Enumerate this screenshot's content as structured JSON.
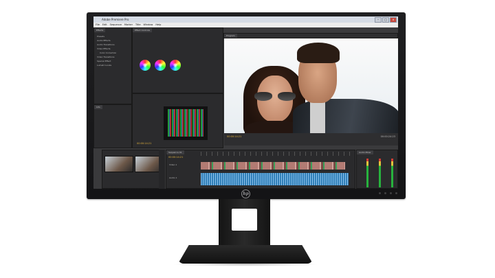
{
  "app": {
    "window_title": "Adobe Premiere Pro",
    "menu": [
      "File",
      "Edit",
      "Sequence",
      "Marker",
      "Title",
      "Window",
      "Help"
    ],
    "window_controls": [
      "–",
      "□",
      "×"
    ]
  },
  "panels": {
    "effects_tab": "Effects",
    "effect_controls_tab": "Effect Controls",
    "program_tab": "Program",
    "info_tab": "Info",
    "timeline_tab": "Sequence 01",
    "mixer_tab": "Audio Mixer",
    "effects_tree": [
      "Presets",
      "Audio Effects",
      "Audio Transitions",
      "Video Effects",
      "Color Correction",
      "Video Transitions",
      "Special Effect",
      "Lumetri Looks"
    ]
  },
  "timecodes": {
    "program_current": "00:00:14:21",
    "program_duration": "00:00:24:23",
    "timeline_current": "00:00:14:21",
    "source_current": "00:00:14:21"
  },
  "tracks": {
    "video": "Video 1",
    "audio": "Audio 1"
  },
  "brand": {
    "logo_text": "hp"
  }
}
